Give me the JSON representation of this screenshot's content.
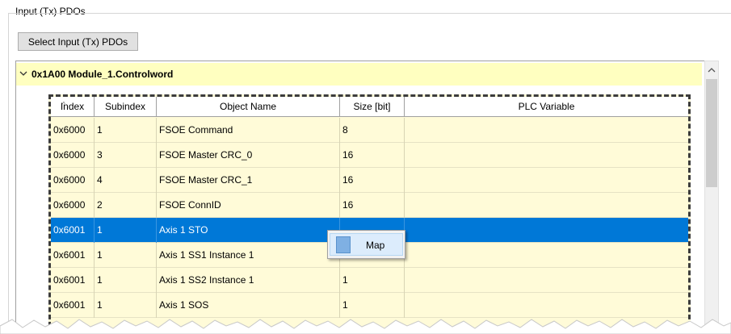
{
  "group": {
    "title": "Input (Tx) PDOs"
  },
  "toolbar": {
    "select_label": "Select Input (Tx) PDOs"
  },
  "tree": {
    "header_title": "0x1A00 Module_1.Controlword"
  },
  "table": {
    "columns": [
      "Index",
      "Subindex",
      "Object Name",
      "Size [bit]",
      "PLC Variable"
    ],
    "rows": [
      {
        "index": "0x6000",
        "subindex": "1",
        "name": "FSOE Command",
        "size": "8",
        "plc": ""
      },
      {
        "index": "0x6000",
        "subindex": "3",
        "name": "FSOE Master CRC_0",
        "size": "16",
        "plc": ""
      },
      {
        "index": "0x6000",
        "subindex": "4",
        "name": "FSOE Master CRC_1",
        "size": "16",
        "plc": ""
      },
      {
        "index": "0x6000",
        "subindex": "2",
        "name": "FSOE ConnID",
        "size": "16",
        "plc": ""
      },
      {
        "index": "0x6001",
        "subindex": "1",
        "name": "Axis 1 STO",
        "size": "",
        "plc": "",
        "selected": true
      },
      {
        "index": "0x6001",
        "subindex": "1",
        "name": "Axis 1 SS1 Instance 1",
        "size": "1",
        "plc": ""
      },
      {
        "index": "0x6001",
        "subindex": "1",
        "name": "Axis 1 SS2 Instance 1",
        "size": "1",
        "plc": ""
      },
      {
        "index": "0x6001",
        "subindex": "1",
        "name": "Axis 1 SOS",
        "size": "1",
        "plc": ""
      }
    ]
  },
  "context_menu": {
    "items": [
      {
        "label": "Map",
        "icon": "map-icon"
      }
    ]
  },
  "colors": {
    "header_bg": "#ffffc0",
    "table_bg": "#fffbd8",
    "selected": "#0078d7"
  }
}
